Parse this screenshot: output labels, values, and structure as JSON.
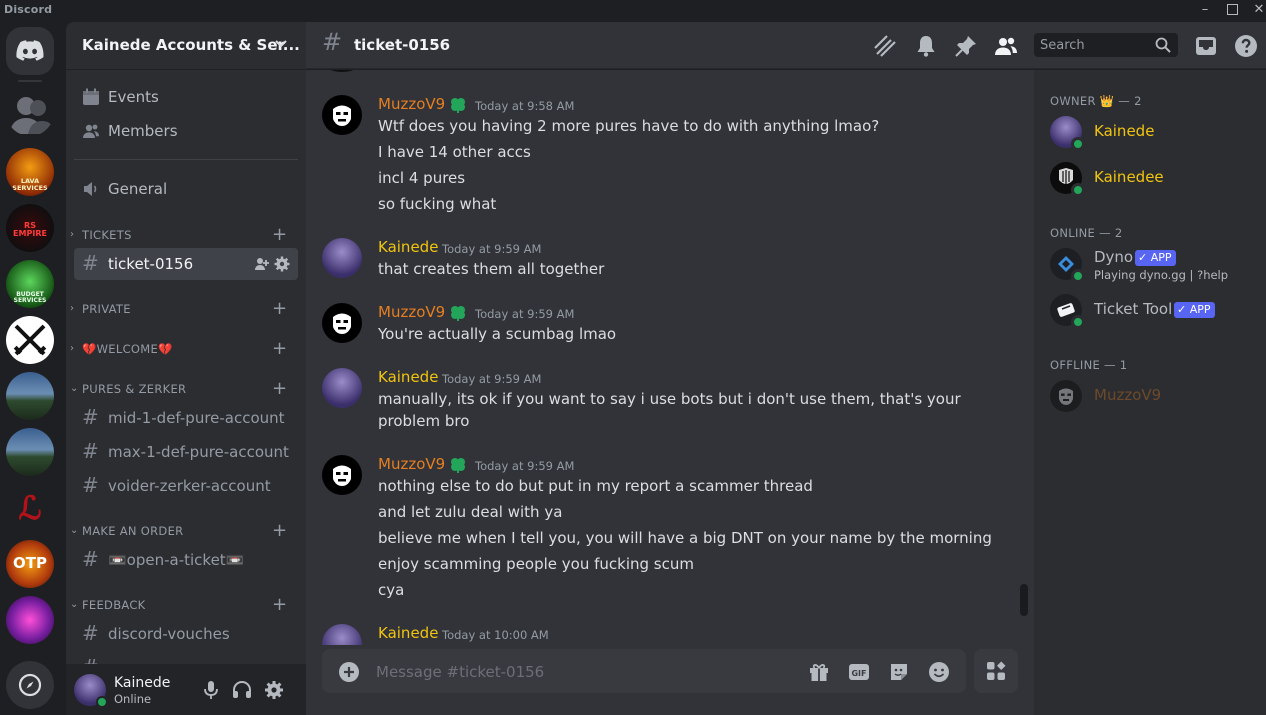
{
  "window": {
    "title": "Discord"
  },
  "colors": {
    "muzzo": "#e67e22",
    "kainede": "#f1c40f",
    "online": "#23a55a",
    "blurple": "#5865f2"
  },
  "rail": {
    "servers": [
      {
        "label": "LAVA SERVICES",
        "icon": "lava-services-server-icon"
      },
      {
        "label": "RS EMPIRE",
        "icon": "rs-empire-server-icon"
      },
      {
        "label": "BUDGET SERVICES",
        "icon": "budget-services-server-icon"
      },
      {
        "label": "",
        "icon": "crossed-swords-server-icon"
      },
      {
        "label": "",
        "icon": "landscape-server-icon"
      },
      {
        "label": "",
        "icon": "landscape-server-icon-2"
      },
      {
        "label": "",
        "icon": "red-letter-server-icon"
      },
      {
        "label": "OTP",
        "icon": "otp-server-icon"
      },
      {
        "label": "",
        "icon": "neon-server-icon"
      }
    ]
  },
  "sidebar": {
    "guild_name": "Kainede Accounts & Ser...",
    "events_label": "Events",
    "members_label": "Members",
    "general_label": "General",
    "categories": {
      "tickets": "TICKETS",
      "private": "PRIVATE",
      "welcome": "💔WELCOME💔",
      "pures": "PURES & ZERKER",
      "order": "MAKE AN ORDER",
      "feedback": "FEEDBACK"
    },
    "channels": {
      "ticket": "ticket-0156",
      "mid": "mid-1-def-pure-account",
      "max": "max-1-def-pure-account",
      "voider": "voider-zerker-account",
      "open": "📼open-a-ticket📼",
      "vouches": "discord-vouches"
    }
  },
  "user_panel": {
    "name": "Kainede",
    "status": "Online"
  },
  "header": {
    "channel": "ticket-0156",
    "search_placeholder": "Search"
  },
  "messages": [
    {
      "author": "MuzzoV9",
      "time": "Today at 9:58 AM",
      "lines": [
        "Wtf does you having 2 more pures have to do with anything lmao?",
        "I have 14 other accs",
        "incl 4 pures",
        "so fucking what"
      ]
    },
    {
      "author": "Kainede",
      "time": "Today at 9:59 AM",
      "lines": [
        "that creates them all together"
      ]
    },
    {
      "author": "MuzzoV9",
      "time": "Today at 9:59 AM",
      "lines": [
        "You're actually a scumbag lmao"
      ]
    },
    {
      "author": "Kainede",
      "time": "Today at 9:59 AM",
      "lines": [
        "manually, its ok if you want to say i use bots but i don't use them, that's your problem bro"
      ]
    },
    {
      "author": "MuzzoV9",
      "time": "Today at 9:59 AM",
      "lines": [
        "nothing else to do but put in my report a scammer thread",
        "and let zulu deal with ya",
        "believe me when I tell you, you will have a big  DNT on your name by the morning",
        "enjoy scamming people you fucking scum",
        "cya"
      ]
    },
    {
      "author": "Kainede",
      "time": "Today at 10:00 AM",
      "lines": []
    }
  ],
  "composer": {
    "placeholder": "Message #ticket-0156"
  },
  "member_list": {
    "owner_header": "OWNER 👑 — 2",
    "online_header": "ONLINE — 2",
    "offline_header": "OFFLINE — 1",
    "owners": [
      {
        "name": "Kainede"
      },
      {
        "name": "Kainedee"
      }
    ],
    "online": [
      {
        "name": "Dyno",
        "tag": "APP",
        "activity": "Playing dyno.gg | ?help"
      },
      {
        "name": "Ticket Tool",
        "tag": "APP"
      }
    ],
    "offline": [
      {
        "name": "MuzzoV9"
      }
    ]
  }
}
